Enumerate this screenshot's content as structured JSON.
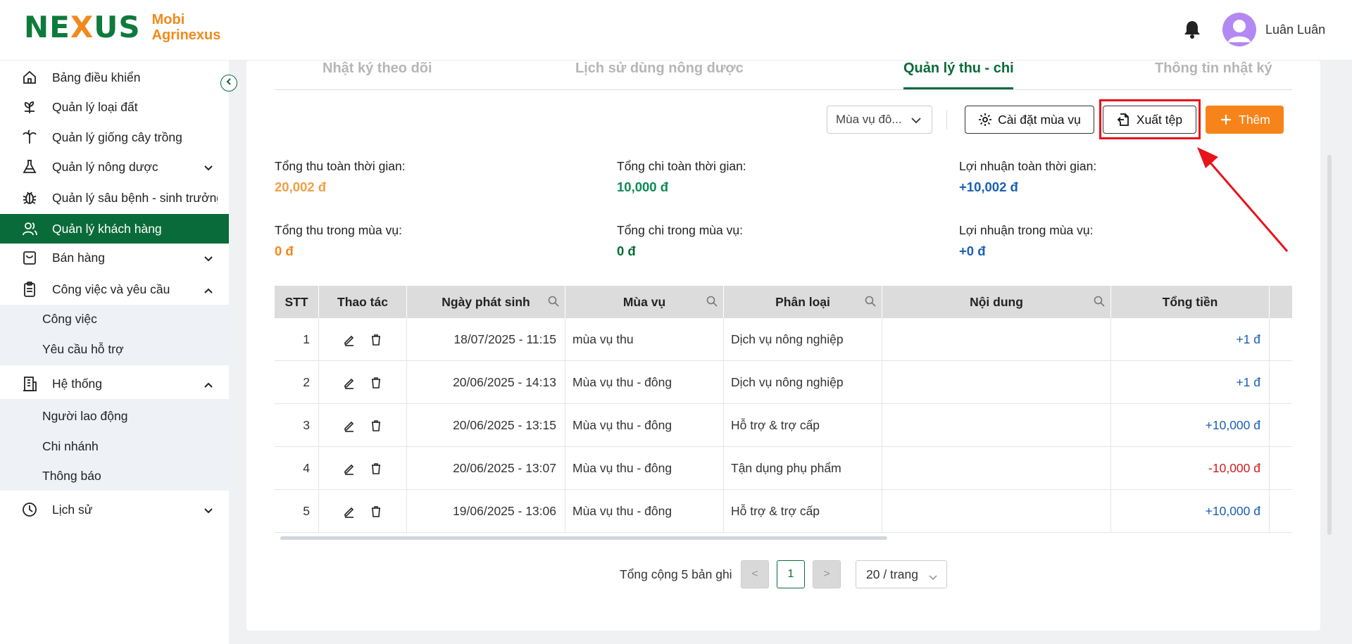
{
  "header": {
    "logo_mark": "NE",
    "logo_mark_x": "X",
    "logo_mark_end": "US",
    "brand_line1": "Mobi",
    "brand_line2": "Agrinexus",
    "username": "Luân Luân"
  },
  "sidebar": {
    "items": [
      {
        "label": "Bảng điều khiển"
      },
      {
        "label": "Quản lý loại đất"
      },
      {
        "label": "Quản lý giống cây trồng"
      },
      {
        "label": "Quản lý nông dược"
      },
      {
        "label": "Quản lý sâu bệnh - sinh trưởng"
      },
      {
        "label": "Quản lý khách hàng"
      },
      {
        "label": "Bán hàng"
      },
      {
        "label": "Công việc và yêu cầu"
      },
      {
        "label": "Hệ thống"
      },
      {
        "label": "Lịch sử"
      }
    ],
    "sub_work": [
      "Công việc",
      "Yêu cầu hỗ trợ"
    ],
    "sub_system": [
      "Người lao động",
      "Chi nhánh",
      "Thông báo"
    ]
  },
  "tabs": [
    "Nhật ký theo dõi",
    "Lịch sử dùng nông dược",
    "Quản lý thu - chi",
    "Thông tin nhật ký"
  ],
  "toolbar": {
    "season_select": "Mùa vụ đô...",
    "settings_label": "Cài đặt mùa vụ",
    "export_label": "Xuất tệp",
    "add_label": "Thêm"
  },
  "stats": {
    "total_income_all_label": "Tổng thu toàn thời gian:",
    "total_income_all": "20,002 đ",
    "total_expense_all_label": "Tổng chi toàn thời gian:",
    "total_expense_all": "10,000 đ",
    "profit_all_label": "Lợi nhuận toàn thời gian:",
    "profit_all": "+10,002 đ",
    "total_income_season_label": "Tổng thu trong mùa vụ:",
    "total_income_season": "0 đ",
    "total_expense_season_label": "Tổng chi trong mùa vụ:",
    "total_expense_season": "0 đ",
    "profit_season_label": "Lợi nhuận trong mùa vụ:",
    "profit_season": "+0 đ"
  },
  "table": {
    "headers": [
      "STT",
      "Thao tác",
      "Ngày phát sinh",
      "Mùa vụ",
      "Phân loại",
      "Nội dung",
      "Tổng tiền"
    ],
    "rows": [
      {
        "stt": "1",
        "date": "18/07/2025 - 11:15",
        "season": "mùa vụ thu",
        "category": "Dịch vụ nông nghiệp",
        "content": "",
        "amount": "+1 đ",
        "sign": "pos"
      },
      {
        "stt": "2",
        "date": "20/06/2025 - 14:13",
        "season": "Mùa vụ thu - đông",
        "category": "Dịch vụ nông nghiệp",
        "content": "",
        "amount": "+1 đ",
        "sign": "pos"
      },
      {
        "stt": "3",
        "date": "20/06/2025 - 13:15",
        "season": "Mùa vụ thu - đông",
        "category": "Hỗ trợ & trợ cấp",
        "content": "",
        "amount": "+10,000 đ",
        "sign": "pos"
      },
      {
        "stt": "4",
        "date": "20/06/2025 - 13:07",
        "season": "Mùa vụ thu - đông",
        "category": "Tận dụng phụ phẩm",
        "content": "",
        "amount": "-10,000 đ",
        "sign": "neg"
      },
      {
        "stt": "5",
        "date": "19/06/2025 - 13:06",
        "season": "Mùa vụ thu - đông",
        "category": "Hỗ trợ & trợ cấp",
        "content": "",
        "amount": "+10,000 đ",
        "sign": "pos"
      }
    ]
  },
  "pagination": {
    "total_text": "Tổng cộng 5 bản ghi",
    "current_page": "1",
    "prev": "<",
    "next": ">",
    "page_size": "20 / trang"
  },
  "colors": {
    "brand_green": "#0a6b3a",
    "accent_orange": "#f7841b",
    "income_orange": "#f0a045",
    "expense_green": "#0c8a55",
    "profit_blue": "#1a5fb4",
    "negative_red": "#d11b1b",
    "highlight_red": "#e8131b"
  }
}
